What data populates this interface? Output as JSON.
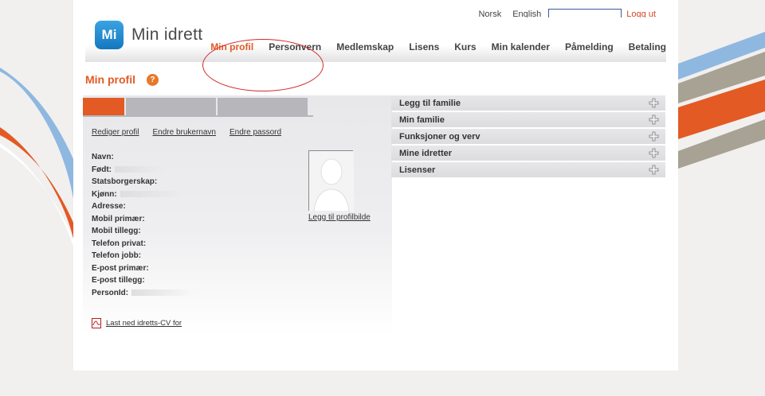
{
  "util": {
    "lang_no": "Norsk",
    "lang_en": "English",
    "search_value": "",
    "logout": "Logg ut"
  },
  "logo": {
    "badge": "Mi",
    "text": "Min idrett"
  },
  "nav": {
    "items": [
      "Min profil",
      "Personvern",
      "Medlemskap",
      "Lisens",
      "Kurs",
      "Min kalender",
      "Påmelding",
      "Betaling"
    ],
    "active_index": 0
  },
  "page": {
    "title": "Min profil",
    "help_glyph": "?"
  },
  "profile": {
    "links": [
      "Rediger profil",
      "Endre brukernavn",
      "Endre passord"
    ],
    "fields": [
      "Navn:",
      "Født:",
      "Statsborgerskap:",
      "Kjønn:",
      "Adresse:",
      "Mobil primær:",
      "Mobil tillegg:",
      "Telefon privat:",
      "Telefon jobb:",
      "E-post primær:",
      "E-post tillegg:",
      "PersonId:"
    ],
    "photo_link": "Legg til profilbilde",
    "cv_link": "Last ned idretts-CV for"
  },
  "accordion": {
    "items": [
      "Legg til familie",
      "Min familie",
      "Funksjoner og verv",
      "Mine idretter",
      "Lisenser"
    ]
  },
  "colors": {
    "accent": "#e35a24",
    "logo_blue": "#1f8fd6",
    "logout_red": "#d9462b"
  }
}
